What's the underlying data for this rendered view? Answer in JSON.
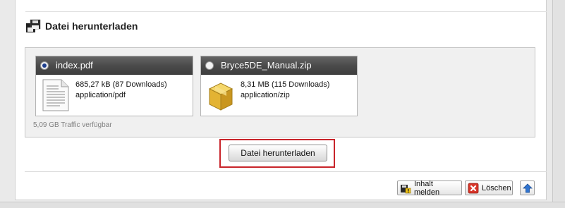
{
  "section": {
    "title": "Datei herunterladen",
    "icon": "floppy-disk-icon"
  },
  "files": [
    {
      "name": "index.pdf",
      "size": "685,27 kB (87 Downloads)",
      "mime": "application/pdf",
      "selected": true,
      "icon": "pdf-document-icon"
    },
    {
      "name": "Bryce5DE_Manual.zip",
      "size": "8,31 MB (115 Downloads)",
      "mime": "application/zip",
      "selected": false,
      "icon": "zip-archive-box-icon"
    }
  ],
  "traffic": "5,09 GB Traffic verfügbar",
  "download_button": "Datei herunterladen",
  "actions": {
    "report_label": "Inhalt melden",
    "delete_label": "Löschen",
    "up_icon": "arrow-up-icon"
  },
  "colors": {
    "highlight": "#c8242a",
    "card_header": "#4a4a4a"
  }
}
